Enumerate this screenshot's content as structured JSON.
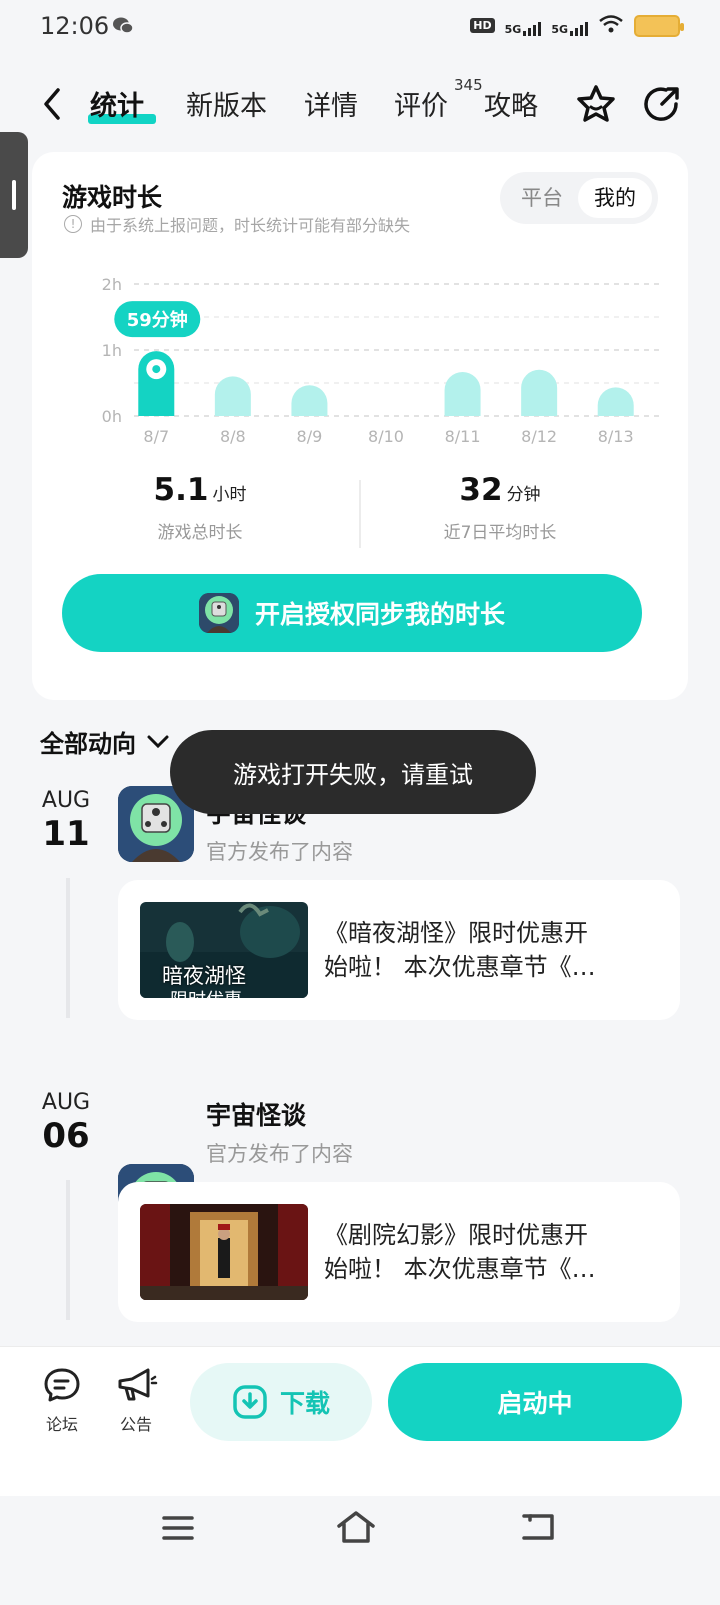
{
  "status_bar": {
    "time": "12:06",
    "hd": "HD",
    "net1": "5G",
    "net2": "5G"
  },
  "nav": {
    "tabs": [
      {
        "label": "统计"
      },
      {
        "label": "新版本"
      },
      {
        "label": "详情"
      },
      {
        "label": "评价"
      },
      {
        "label": "攻略"
      }
    ],
    "review_count": "345"
  },
  "stats_card": {
    "title": "游戏时长",
    "notice": "由于系统上报问题，时长统计可能有部分缺失",
    "toggle": {
      "platform": "平台",
      "mine": "我的"
    },
    "total": {
      "value": "5.1",
      "unit": "小时",
      "label": "游戏总时长"
    },
    "average": {
      "value": "32",
      "unit": "分钟",
      "label": "近7日平均时长"
    },
    "auth_button": "开启授权同步我的时长"
  },
  "chart_data": {
    "type": "bar",
    "categories": [
      "8/7",
      "8/8",
      "8/9",
      "8/10",
      "8/11",
      "8/12",
      "8/13"
    ],
    "values": [
      59,
      36,
      28,
      0,
      40,
      42,
      26
    ],
    "y_unit": "minutes",
    "y_ticks": [
      "0h",
      "1h",
      "2h"
    ],
    "ylim": [
      0,
      120
    ],
    "highlight_index": 0,
    "highlight_label": "59分钟",
    "grid": true,
    "colors": {
      "active": "#14d3c3",
      "inactive": "#b3f1ec"
    }
  },
  "feed": {
    "filter_label": "全部动向",
    "posts": [
      {
        "month": "AUG",
        "day": "11",
        "author": "宇宙怪谈",
        "meta": "官方发布了内容",
        "text_line1": "《暗夜湖怪》限时优惠开",
        "text_line2": "始啦！ 本次优惠章节《…",
        "thumb_text": "暗夜湖怪",
        "thumb_text2": "限时优惠"
      },
      {
        "month": "AUG",
        "day": "06",
        "author": "宇宙怪谈",
        "meta": "官方发布了内容",
        "text_line1": "《剧院幻影》限时优惠开",
        "text_line2": "始啦！ 本次优惠章节《…"
      }
    ]
  },
  "toast": "游戏打开失败，请重试",
  "bottom_bar": {
    "forum": "论坛",
    "announcement": "公告",
    "download": "下载",
    "launch": "启动中"
  }
}
